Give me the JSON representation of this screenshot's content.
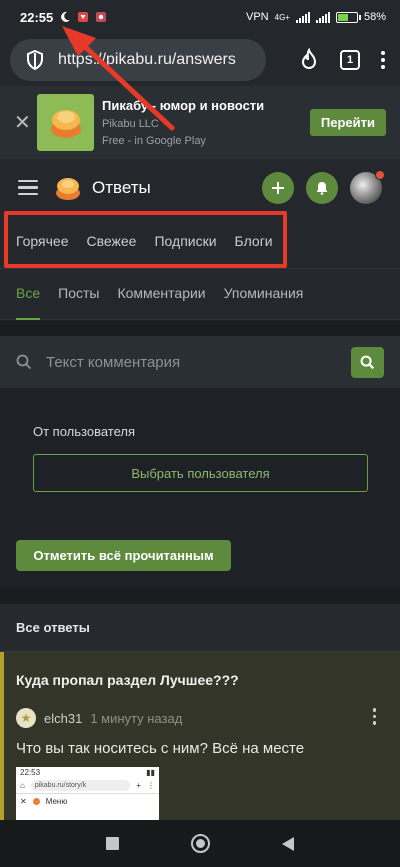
{
  "statusbar": {
    "time": "22:55",
    "vpn": "VPN",
    "network": "4G+",
    "battery": "58%",
    "battery_level": 0.58
  },
  "browser": {
    "url": "https://pikabu.ru/answers",
    "tabs_count": "1"
  },
  "app_banner": {
    "title": "Пикабу - юмор и новости",
    "developer": "Pikabu LLC",
    "store": "Free - in Google Play",
    "button": "Перейти"
  },
  "site_header": {
    "title": "Ответы"
  },
  "top_nav": {
    "items": [
      "Горячее",
      "Свежее",
      "Подписки",
      "Блоги"
    ]
  },
  "sub_nav": {
    "items": [
      "Все",
      "Посты",
      "Комментарии",
      "Упоминания"
    ]
  },
  "search": {
    "placeholder": "Текст комментария"
  },
  "filter": {
    "label": "От пользователя",
    "select_button": "Выбрать пользователя",
    "mark_read_button": "Отметить всё прочитанным"
  },
  "answers": {
    "header": "Все ответы",
    "item": {
      "title": "Куда пропал раздел Лучшее???",
      "user": "elch31",
      "time": "1 минуту назад",
      "text": "Что вы так носитесь с ним? Всё на месте",
      "thumb": {
        "time": "22:53",
        "url": "pikabu.ru/story/k",
        "menu": "Меню"
      }
    }
  },
  "colors": {
    "accent_green": "#5e8a3d",
    "highlight_red": "#e53a28",
    "answer_border": "#b59f2c"
  }
}
